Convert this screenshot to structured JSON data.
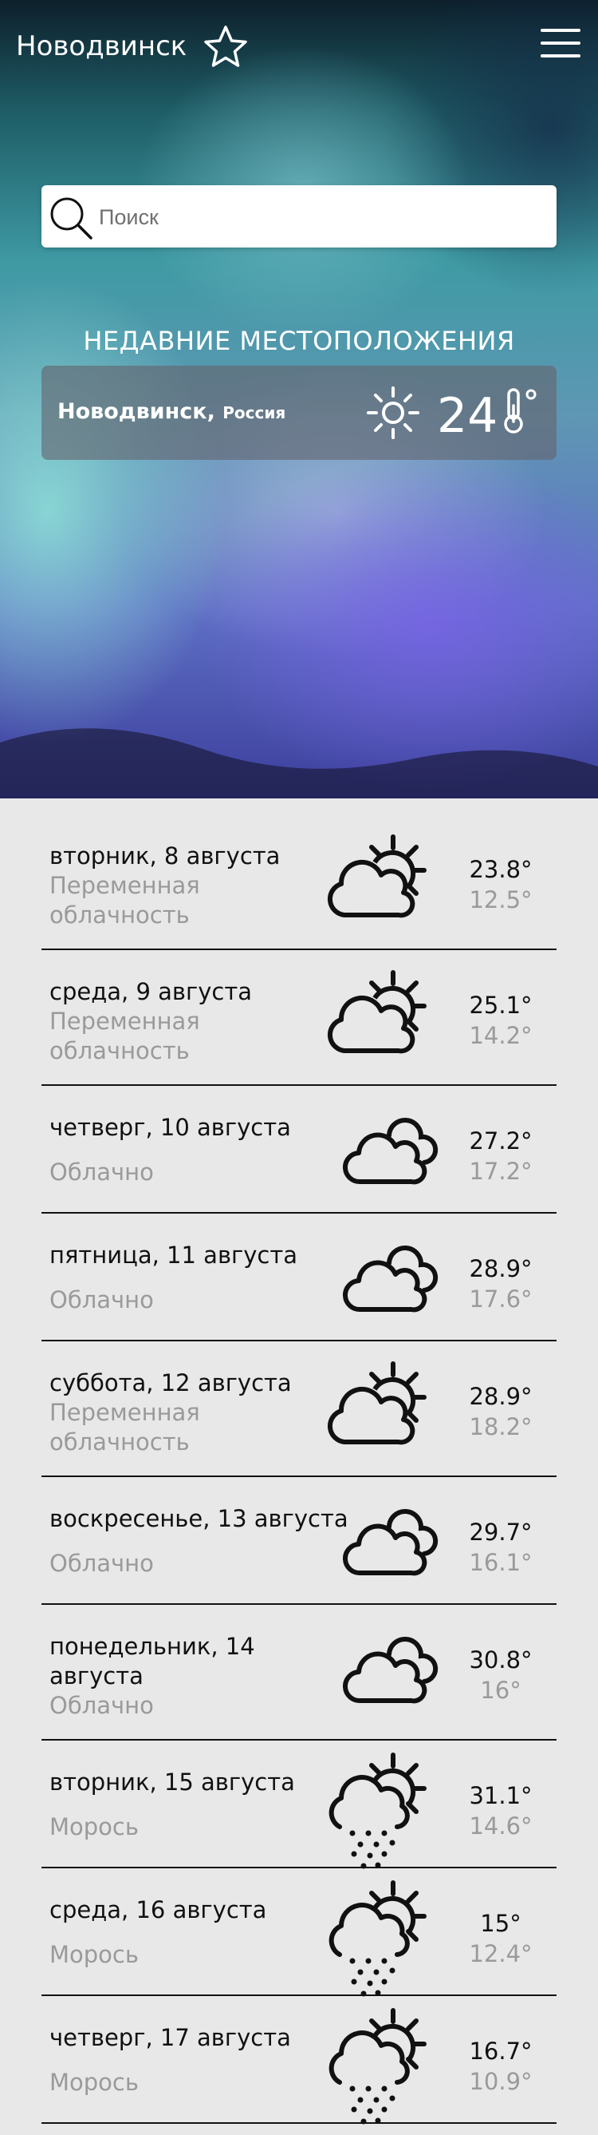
{
  "header": {
    "city": "Новодвинск"
  },
  "search": {
    "placeholder": "Поиск"
  },
  "recent": {
    "heading": "НЕДАВНИЕ МЕСТОПОЛОЖЕНИЯ",
    "city": "Новодвинск,",
    "country": "Россия",
    "temp": "24",
    "icon": "sun-icon"
  },
  "forecast": [
    {
      "day": "вторник, 8 августа",
      "condition": "Переменная облачность",
      "icon": "partly-cloudy-icon",
      "high": "23.8°",
      "low": "12.5°"
    },
    {
      "day": "среда, 9 августа",
      "condition": "Переменная облачность",
      "icon": "partly-cloudy-icon",
      "high": "25.1°",
      "low": "14.2°"
    },
    {
      "day": "четверг, 10 августа",
      "condition": "Облачно",
      "icon": "cloudy-icon",
      "high": "27.2°",
      "low": "17.2°"
    },
    {
      "day": "пятница, 11 августа",
      "condition": "Облачно",
      "icon": "cloudy-icon",
      "high": "28.9°",
      "low": "17.6°"
    },
    {
      "day": "суббота, 12 августа",
      "condition": "Переменная облачность",
      "icon": "partly-cloudy-icon",
      "high": "28.9°",
      "low": "18.2°"
    },
    {
      "day": "воскресенье, 13 августа",
      "condition": "Облачно",
      "icon": "cloudy-icon",
      "high": "29.7°",
      "low": "16.1°"
    },
    {
      "day": "понедельник, 14 августа",
      "condition": "Облачно",
      "icon": "cloudy-icon",
      "high": "30.8°",
      "low": "16°"
    },
    {
      "day": "вторник, 15 августа",
      "condition": "Морось",
      "icon": "drizzle-icon",
      "high": "31.1°",
      "low": "14.6°"
    },
    {
      "day": "среда, 16 августа",
      "condition": "Морось",
      "icon": "drizzle-icon",
      "high": "15°",
      "low": "12.4°"
    },
    {
      "day": "четверг, 17 августа",
      "condition": "Морось",
      "icon": "drizzle-icon",
      "high": "16.7°",
      "low": "10.9°"
    }
  ]
}
